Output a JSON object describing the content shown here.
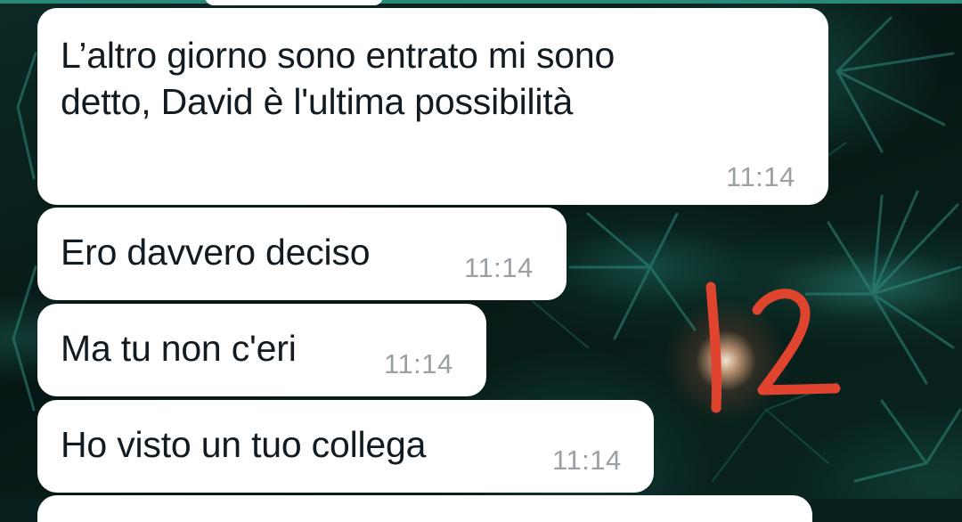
{
  "chat": {
    "messages": [
      {
        "text": "L’altro giorno sono entrato mi sono\ndetto, David è l'ultima possibilità",
        "time": "11:14"
      },
      {
        "text": "Ero davvero deciso",
        "time": "11:14"
      },
      {
        "text": "Ma tu non c'eri",
        "time": "11:14"
      },
      {
        "text": "Ho visto un tuo collega",
        "time": "11:14"
      }
    ]
  },
  "annotation": {
    "text": "12",
    "color": "#e0442f"
  },
  "colors": {
    "bubble": "#ffffff",
    "text": "#111b21",
    "timestamp": "#9aa0a4",
    "accent": "#2a8a7a"
  }
}
